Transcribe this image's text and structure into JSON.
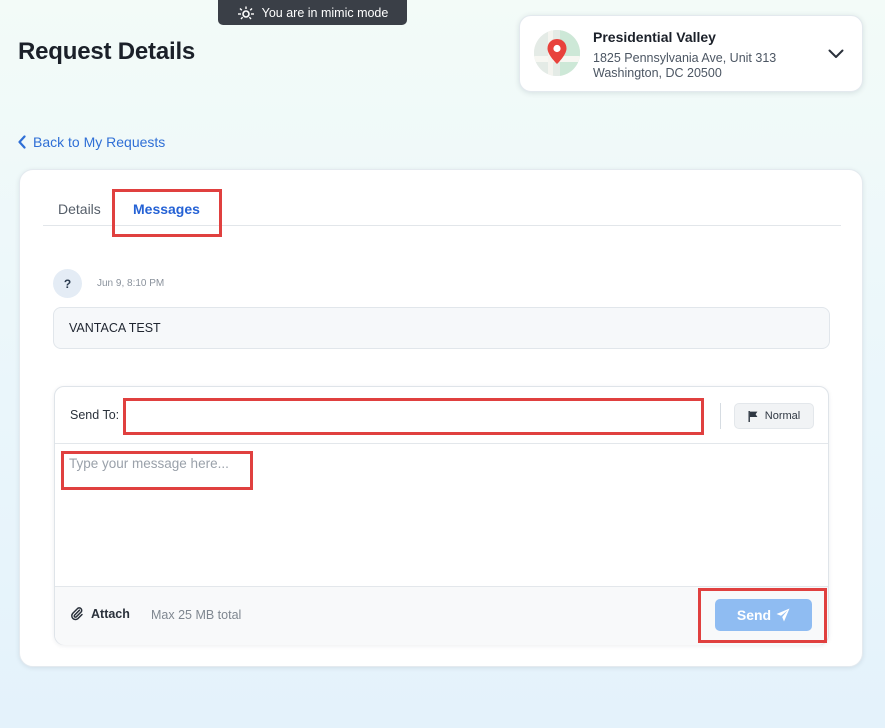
{
  "banner": {
    "text": "You are in mimic mode",
    "icon": "mimic-mode-icon"
  },
  "page": {
    "title": "Request Details"
  },
  "property": {
    "name": "Presidential Valley",
    "address_line1": "1825 Pennsylvania Ave, Unit 313",
    "address_line2": "Washington, DC 20500",
    "thumb_icon": "map-pin-icon",
    "dropdown_icon": "chevron-down-icon"
  },
  "back_link": {
    "label": "Back to My Requests",
    "icon": "chevron-left-icon"
  },
  "tabs": [
    {
      "label": "Details",
      "active": false
    },
    {
      "label": "Messages",
      "active": true
    }
  ],
  "messages": [
    {
      "avatar": "?",
      "timestamp": "Jun 9, 8:10 PM",
      "text": "VANTACA TEST"
    }
  ],
  "composer": {
    "send_to_label": "Send To:",
    "send_to_value": "",
    "priority_label": "Normal",
    "priority_icon": "flag-icon",
    "message_placeholder": "Type your message here...",
    "attach_label": "Attach",
    "attach_icon": "paperclip-icon",
    "max_size": "Max 25 MB total",
    "send_label": "Send",
    "send_icon": "paper-plane-icon"
  },
  "colors": {
    "accent": "#2562d5",
    "send_button": "#8fbcf2",
    "highlight": "#e0403f"
  }
}
